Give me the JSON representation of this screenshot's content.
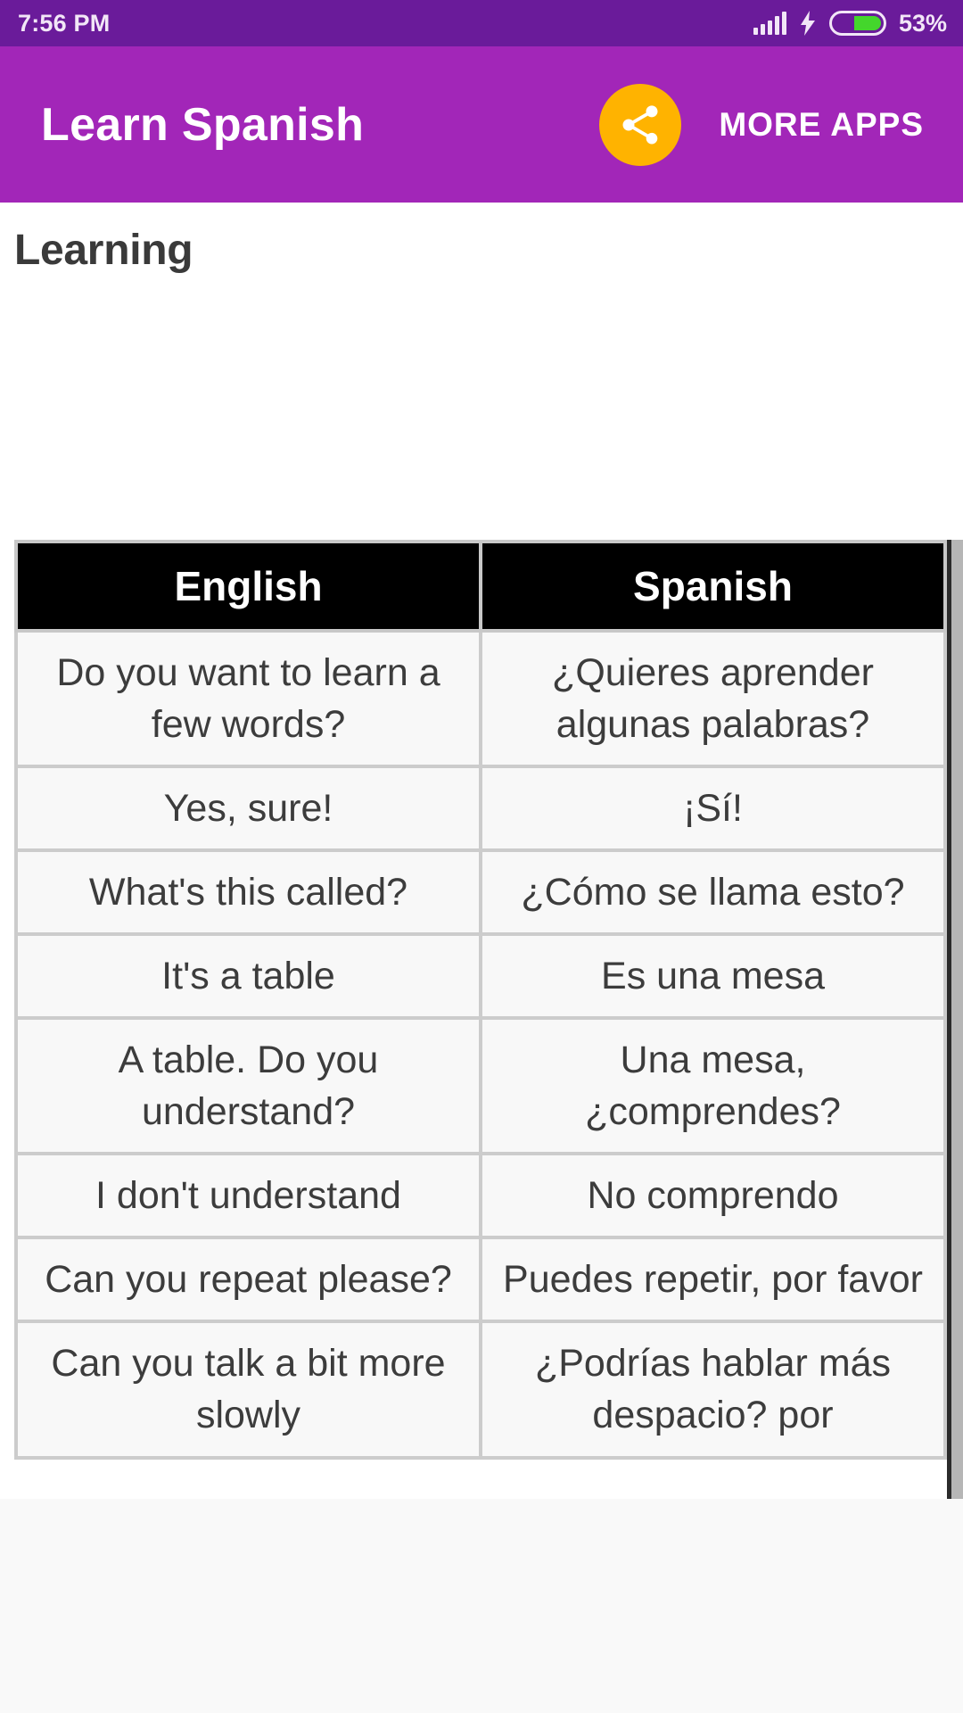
{
  "status_bar": {
    "time": "7:56 PM",
    "battery_percent": "53%",
    "signal_icon": "signal-bars-icon",
    "charging_icon": "lightning-bolt-icon",
    "battery_icon": "battery-icon",
    "colors": {
      "background": "#6A1B9A",
      "text": "#F2E6F7",
      "battery_fill": "#44D62C"
    }
  },
  "app_bar": {
    "title": "Learn Spanish",
    "share_icon": "share-icon",
    "more_apps_label": "MORE APPS",
    "colors": {
      "background": "#A226B8",
      "share_circle": "#FFB300",
      "text": "#FFFFFF"
    }
  },
  "page": {
    "heading": "Learning",
    "colors": {
      "heading_text": "#3A3A3A",
      "background": "#FFFFFF"
    }
  },
  "table": {
    "columns": [
      "English",
      "Spanish"
    ],
    "header_colors": {
      "background": "#000000",
      "text": "#FFFFFF"
    },
    "cell_colors": {
      "background": "#F8F8F8",
      "text": "#3C3C3C",
      "border": "#CCCCCC",
      "outer_border": "#9E9E9E"
    },
    "rows": [
      {
        "english": "Do you want to learn a few words?",
        "spanish": "¿Quieres aprender algunas palabras?"
      },
      {
        "english": "Yes, sure!",
        "spanish": "¡Sí!"
      },
      {
        "english": "What's this called?",
        "spanish": "¿Cómo se llama esto?"
      },
      {
        "english": "It's a table",
        "spanish": "Es una mesa"
      },
      {
        "english": "A table. Do you understand?",
        "spanish": "Una mesa, ¿comprendes?"
      },
      {
        "english": "I don't understand",
        "spanish": "No comprendo"
      },
      {
        "english": "Can you repeat please?",
        "spanish": "Puedes repetir, por favor"
      },
      {
        "english": "Can you talk a bit more slowly",
        "spanish": "¿Podrías hablar más despacio? por"
      }
    ]
  },
  "scrollbar": {
    "name": "vertical-scrollbar",
    "color": "#B6B6B6"
  }
}
